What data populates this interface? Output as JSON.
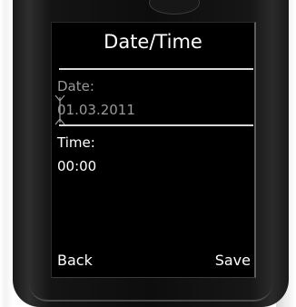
{
  "screen": {
    "title": "Date/Time",
    "date_label": "Date:",
    "date_value": "01.03.2011",
    "time_label": "Time:",
    "time_value": "00:00"
  },
  "softkeys": {
    "left_label": "Back",
    "right_label": "Save"
  },
  "colors": {
    "screen_background": "#000000",
    "active_text": "#ffffff",
    "inactive_text": "#9a9a9a",
    "device_body": "#111111"
  },
  "icons": {
    "cursor": "text-cursor-icon"
  }
}
